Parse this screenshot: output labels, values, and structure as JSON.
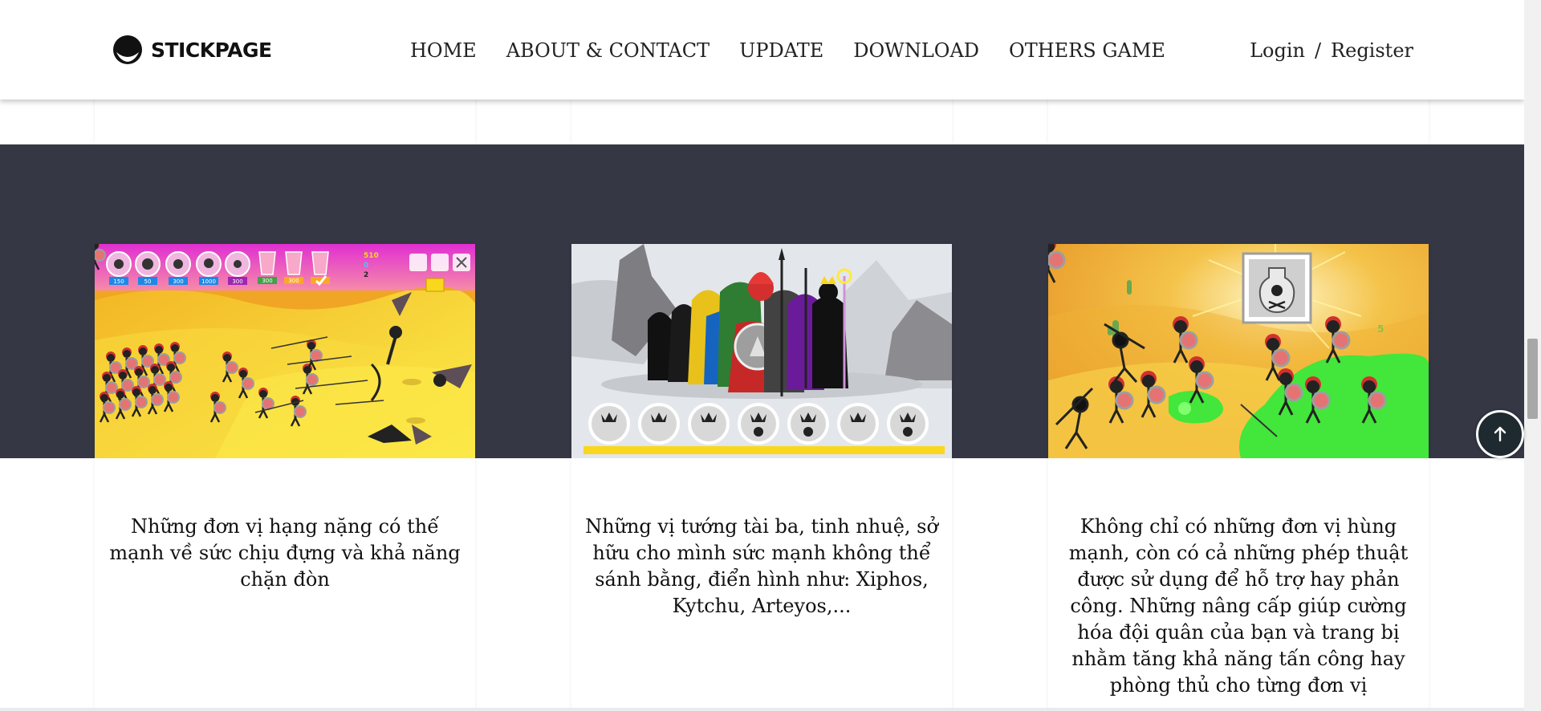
{
  "header": {
    "logo_text": "STICKPAGE",
    "nav": [
      "HOME",
      "ABOUT & CONTACT",
      "UPDATE",
      "DOWNLOAD",
      "OTHERS GAME"
    ],
    "login": "Login",
    "separator": "/",
    "register": "Register"
  },
  "cards": [
    {
      "image_alt": "Heavy units battle scene",
      "description": "Những đơn vị hạng nặng có thế mạnh về sức chịu đựng và khả năng chặn đòn"
    },
    {
      "image_alt": "Generals lineup",
      "description": "Những vị tướng tài ba, tinh nhuệ, sở hữu cho mình sức mạnh không thể sánh bằng, điển hình như: Xiphos, Kytchu, Arteyos,..."
    },
    {
      "image_alt": "Poison spell scene",
      "description": "Không chỉ có những đơn vị hùng mạnh, còn có cả những phép thuật được sử dụng để hỗ trợ hay phản công. Những nâng cấp giúp cường hóa đội quân của bạn và trang bị nhằm tăng khả năng tấn công hay phòng thủ cho từng đơn vị"
    }
  ],
  "game_ui": {
    "upgrade_costs": [
      "150",
      "50",
      "300",
      "1000",
      "300",
      "300",
      "300"
    ],
    "gold": "510",
    "gems": "0",
    "units": "2",
    "skull_count": "5"
  },
  "colors": {
    "band": "#353844",
    "back_to_top": "#1f2a30"
  },
  "icons": {
    "back_to_top": "arrow-up-icon",
    "logo": "stickman-head-icon"
  }
}
